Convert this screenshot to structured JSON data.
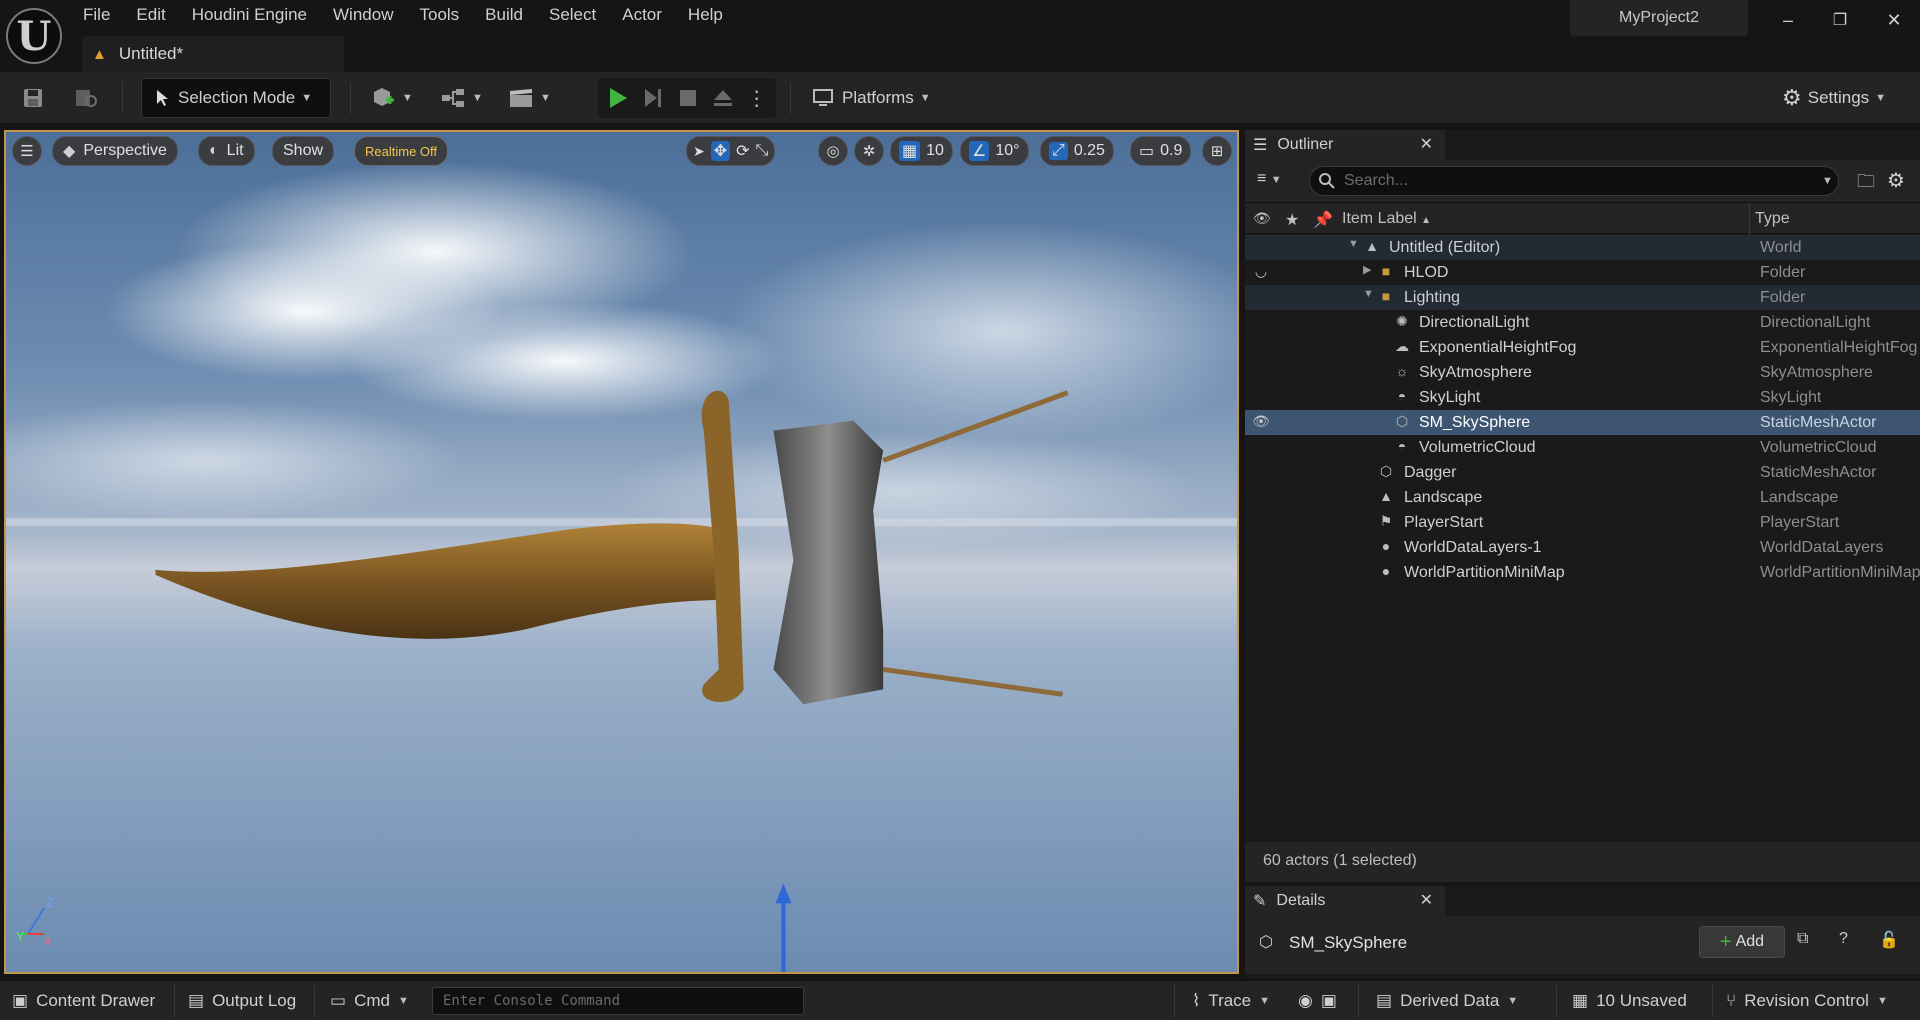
{
  "app": {
    "logo": "U",
    "project_name": "MyProject2",
    "document_tab": "Untitled*"
  },
  "menu": [
    "File",
    "Edit",
    "Houdini Engine",
    "Window",
    "Tools",
    "Build",
    "Select",
    "Actor",
    "Help"
  ],
  "window_controls": {
    "minimize": "–",
    "restore": "❐",
    "close": "✕"
  },
  "toolbar": {
    "selection_mode": "Selection Mode",
    "platforms": "Platforms",
    "settings": "Settings"
  },
  "viewport": {
    "perspective": "Perspective",
    "lit": "Lit",
    "show": "Show",
    "realtime": "Realtime Off",
    "grid_snap": "10",
    "rotation_snap": "10°",
    "scale_snap": "0.25",
    "camera_speed": "0.9",
    "axis_z": "Z",
    "axis_y": "Y",
    "axis_x": "X"
  },
  "outliner": {
    "title": "Outliner",
    "search_placeholder": "Search...",
    "col_label": "Item Label",
    "col_type": "Type",
    "rows": [
      {
        "label": "Untitled (Editor)",
        "type": "World"
      },
      {
        "label": "HLOD",
        "type": "Folder"
      },
      {
        "label": "Lighting",
        "type": "Folder"
      },
      {
        "label": "DirectionalLight",
        "type": "DirectionalLight"
      },
      {
        "label": "ExponentialHeightFog",
        "type": "ExponentialHeightFog"
      },
      {
        "label": "SkyAtmosphere",
        "type": "SkyAtmosphere"
      },
      {
        "label": "SkyLight",
        "type": "SkyLight"
      },
      {
        "label": "SM_SkySphere",
        "type": "StaticMeshActor"
      },
      {
        "label": "VolumetricCloud",
        "type": "VolumetricCloud"
      },
      {
        "label": "Dagger",
        "type": "StaticMeshActor"
      },
      {
        "label": "Landscape",
        "type": "Landscape"
      },
      {
        "label": "PlayerStart",
        "type": "PlayerStart"
      },
      {
        "label": "WorldDataLayers-1",
        "type": "WorldDataLayers"
      },
      {
        "label": "WorldPartitionMiniMap",
        "type": "WorldPartitionMiniMap"
      }
    ],
    "actor_count": "60 actors (1 selected)"
  },
  "details": {
    "title": "Details",
    "selected_name": "SM_SkySphere",
    "add_label": "Add"
  },
  "statusbar": {
    "content_drawer": "Content Drawer",
    "output_log": "Output Log",
    "cmd": "Cmd",
    "console_placeholder": "Enter Console Command",
    "trace": "Trace",
    "derived_data": "Derived Data",
    "unsaved": "10 Unsaved",
    "revision_control": "Revision Control"
  },
  "colors": {
    "accent_blue": "#2367b8",
    "selection_row": "#3d5570",
    "viewport_border": "#c2964a",
    "play_green": "#3fb43f",
    "realtime_yellow": "#f0c94a"
  }
}
